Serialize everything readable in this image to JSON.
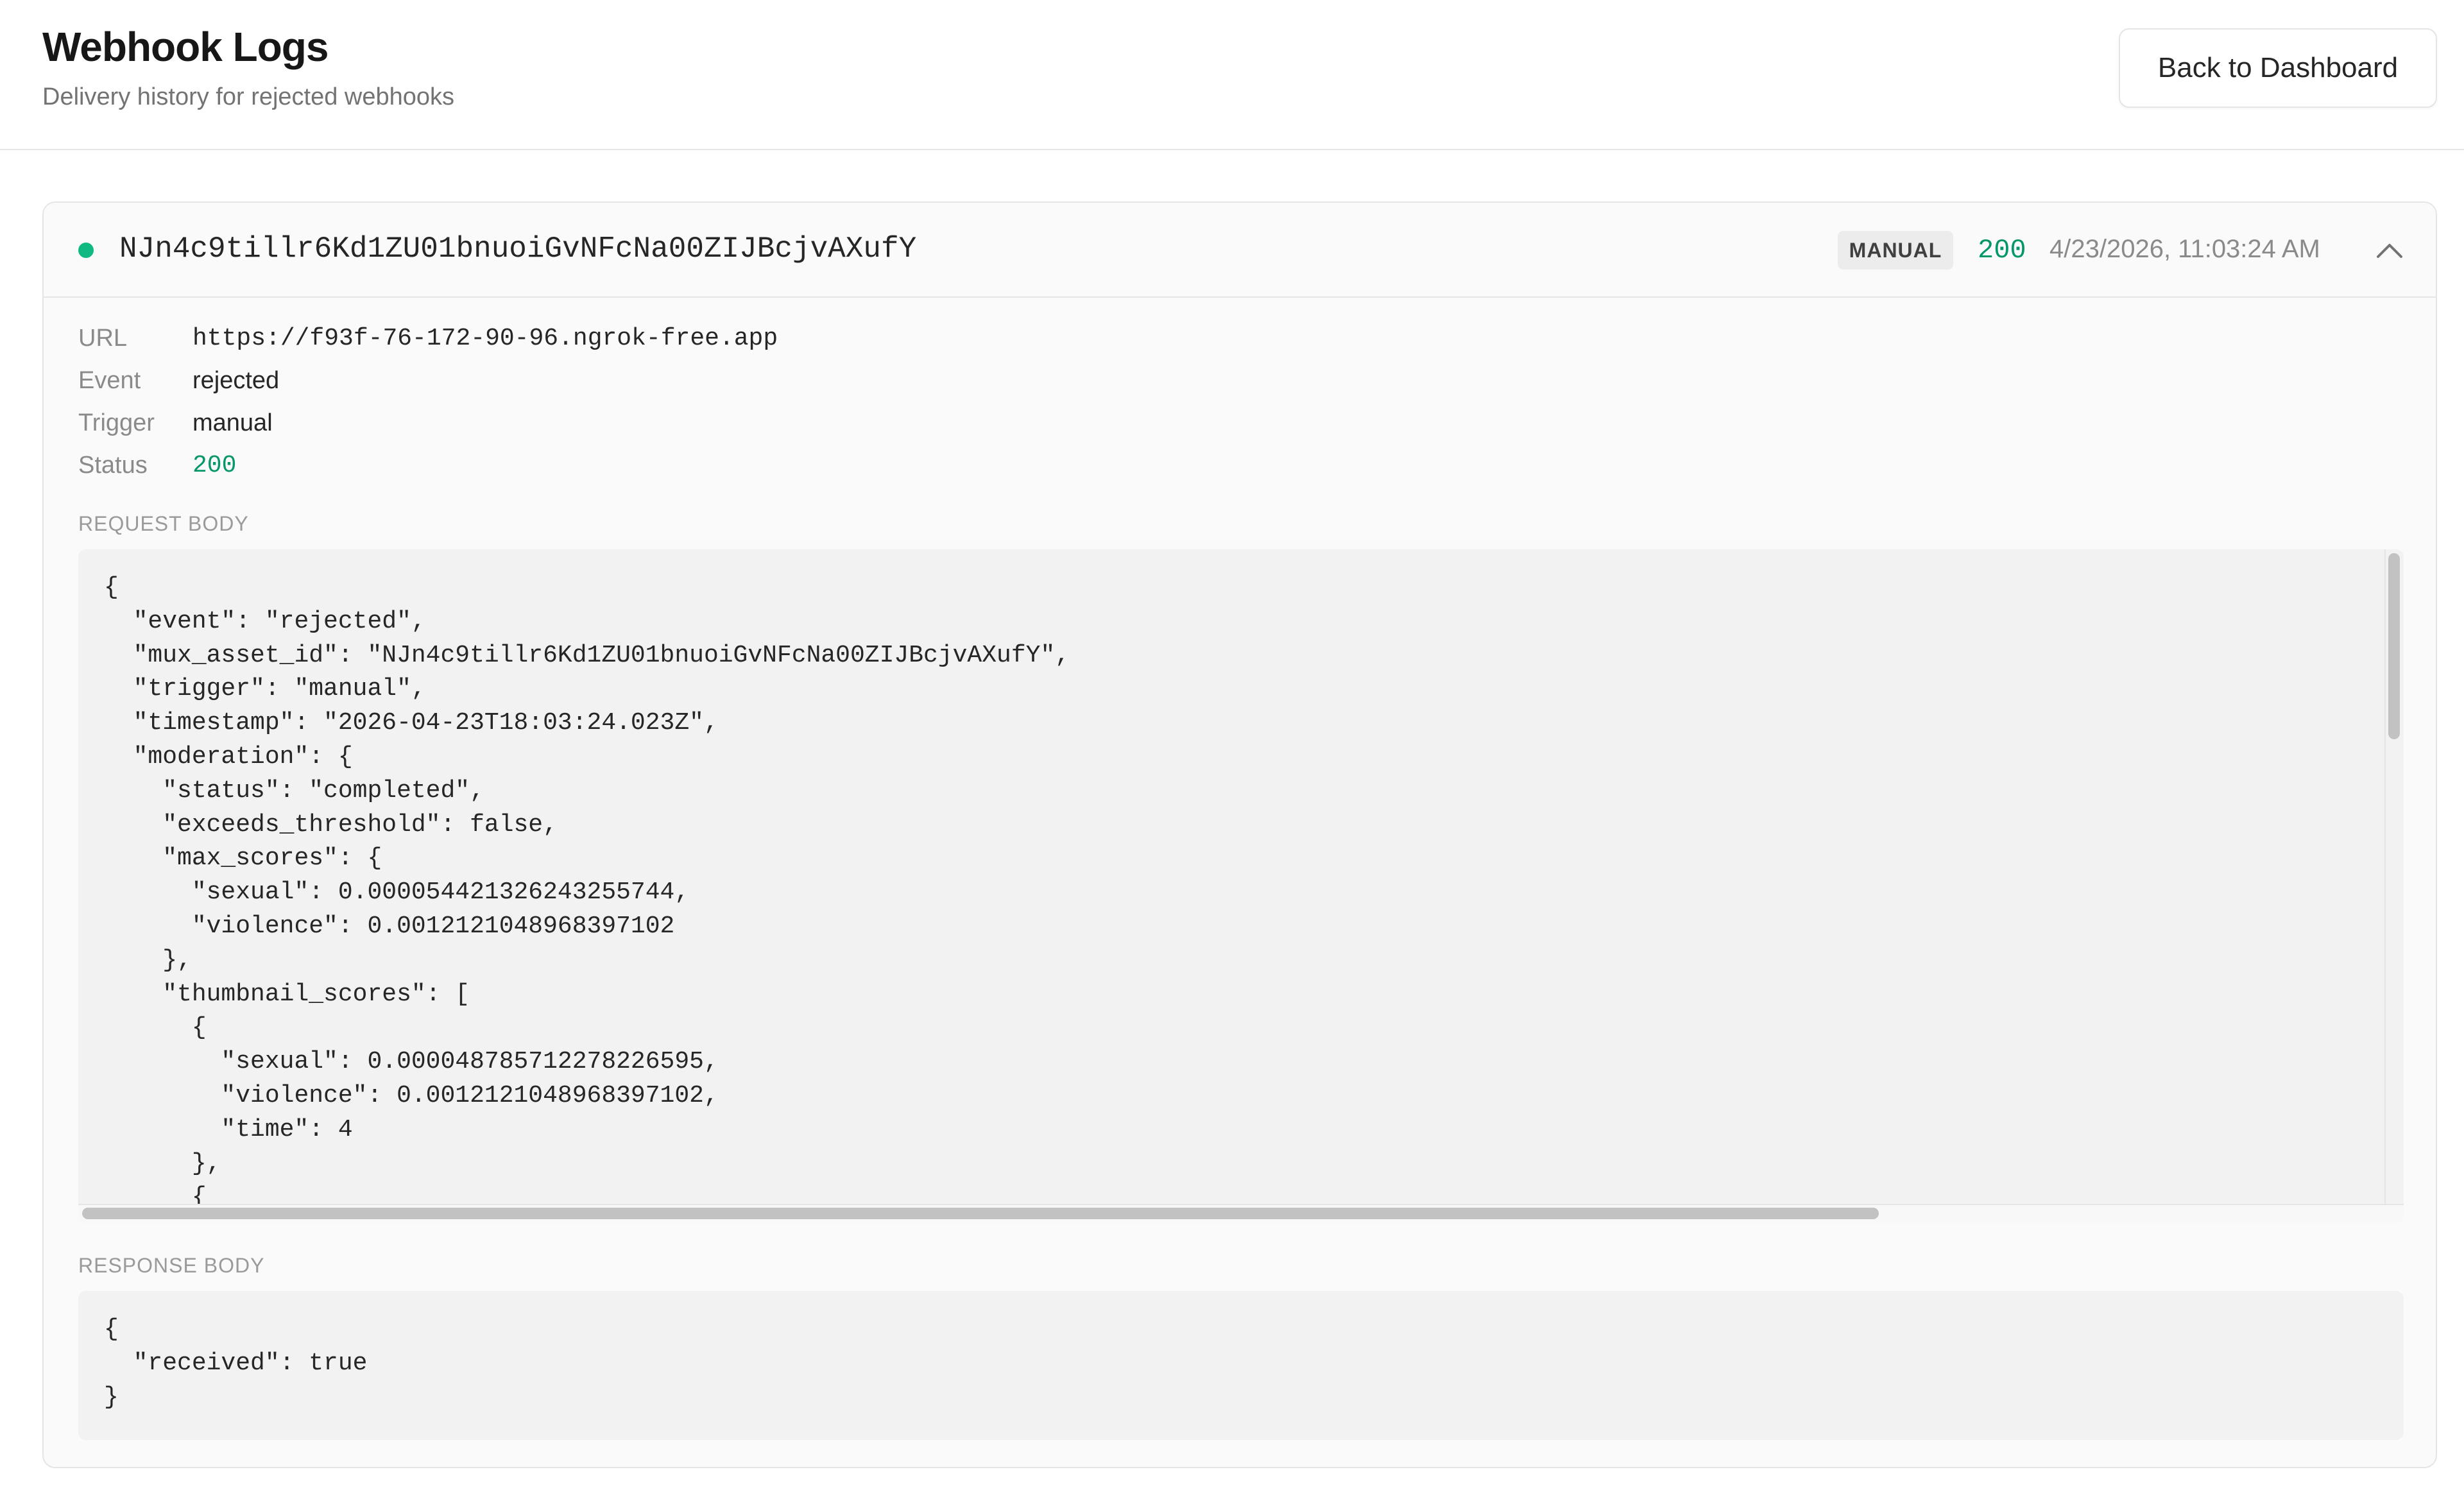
{
  "header": {
    "title": "Webhook Logs",
    "subtitle": "Delivery history for rejected webhooks",
    "back_button_label": "Back to Dashboard"
  },
  "log": {
    "asset_id": "NJn4c9tillr6Kd1ZU01bnuoiGvNFcNa00ZIJBcjvAXufY",
    "trigger_badge": "MANUAL",
    "status_code": "200",
    "timestamp": "4/23/2026, 11:03:24 AM",
    "status_dot_color": "#10b981",
    "expanded": true,
    "details": [
      {
        "label": "URL",
        "value": "https://f93f-76-172-90-96.ngrok-free.app"
      },
      {
        "label": "Event",
        "value": "rejected"
      },
      {
        "label": "Trigger",
        "value": "manual"
      },
      {
        "label": "Status",
        "value": "200"
      }
    ],
    "request_body_label": "REQUEST BODY",
    "request_body": "{\n  \"event\": \"rejected\",\n  \"mux_asset_id\": \"NJn4c9tillr6Kd1ZU01bnuoiGvNFcNa00ZIJBcjvAXufY\",\n  \"trigger\": \"manual\",\n  \"timestamp\": \"2026-04-23T18:03:24.023Z\",\n  \"moderation\": {\n    \"status\": \"completed\",\n    \"exceeds_threshold\": false,\n    \"max_scores\": {\n      \"sexual\": 0.000054421326243255744,\n      \"violence\": 0.0012121048968397102\n    },\n    \"thumbnail_scores\": [\n      {\n        \"sexual\": 0.000048785712278226595,\n        \"violence\": 0.0012121048968397102,\n        \"time\": 4\n      },\n      {",
    "response_body_label": "RESPONSE BODY",
    "response_body": "{\n  \"received\": true\n}"
  },
  "colors": {
    "success_green": "#059669",
    "status_dot": "#10b981",
    "muted_text": "#8a8a8a"
  },
  "icons": {
    "collapse": "chevron-up-icon"
  }
}
